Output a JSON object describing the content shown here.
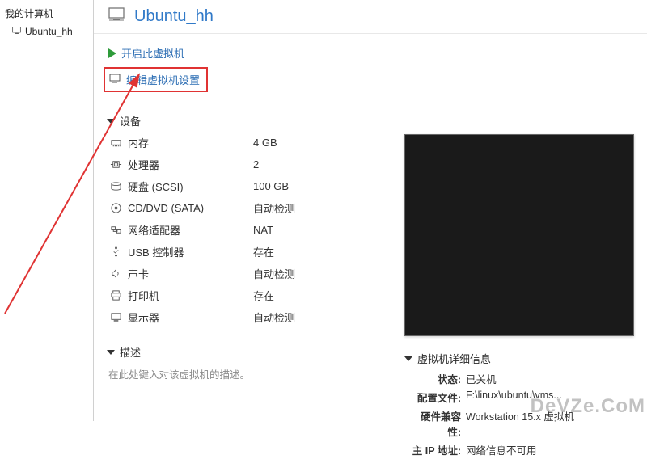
{
  "sidebar": {
    "header": "我的计算机",
    "items": [
      {
        "label": "Ubuntu_hh"
      }
    ]
  },
  "vm": {
    "title": "Ubuntu_hh"
  },
  "actions": {
    "start": "开启此虚拟机",
    "edit": "编辑虚拟机设置"
  },
  "devices": {
    "header": "设备",
    "rows": [
      {
        "name": "内存",
        "value": "4 GB",
        "icon": "memory"
      },
      {
        "name": "处理器",
        "value": "2",
        "icon": "cpu"
      },
      {
        "name": "硬盘 (SCSI)",
        "value": "100 GB",
        "icon": "disk"
      },
      {
        "name": "CD/DVD (SATA)",
        "value": "自动检测",
        "icon": "cd"
      },
      {
        "name": "网络适配器",
        "value": "NAT",
        "icon": "net"
      },
      {
        "name": "USB 控制器",
        "value": "存在",
        "icon": "usb"
      },
      {
        "name": "声卡",
        "value": "自动检测",
        "icon": "sound"
      },
      {
        "name": "打印机",
        "value": "存在",
        "icon": "printer"
      },
      {
        "name": "显示器",
        "value": "自动检测",
        "icon": "display"
      }
    ]
  },
  "description": {
    "header": "描述",
    "placeholder": "在此处键入对该虚拟机的描述。"
  },
  "vmdetails": {
    "header": "虚拟机详细信息",
    "rows": [
      {
        "label": "状态:",
        "value": "已关机"
      },
      {
        "label": "配置文件:",
        "value": "F:\\linux\\ubuntu\\vms..."
      },
      {
        "label": "硬件兼容性:",
        "value": "Workstation 15.x 虚拟机"
      },
      {
        "label": "主 IP 地址:",
        "value": "网络信息不可用"
      }
    ]
  },
  "watermark": "DeVZe.CoM"
}
